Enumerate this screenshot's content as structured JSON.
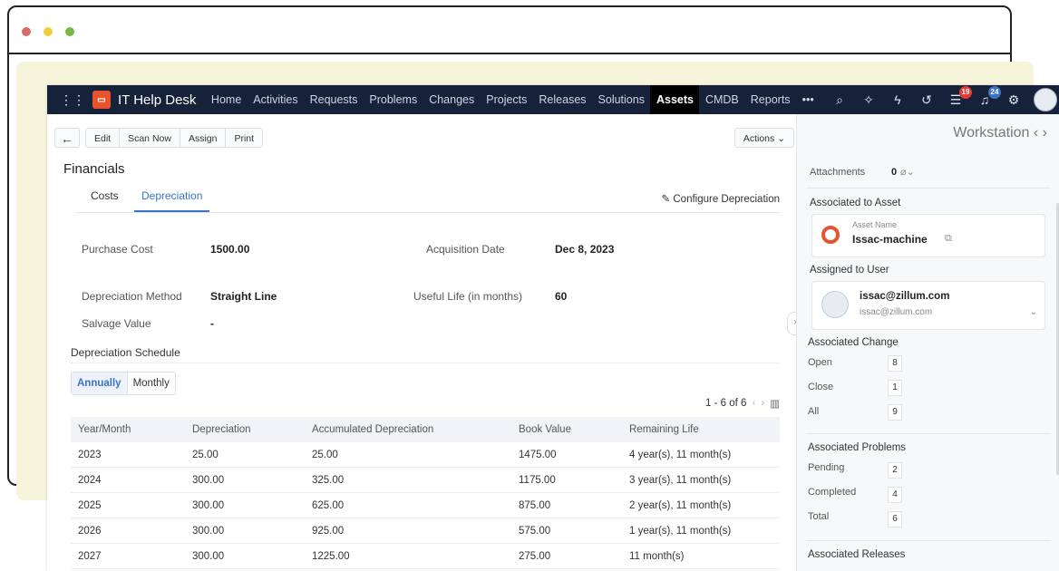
{
  "window": {
    "dot_colors": [
      "#d96b6b",
      "#f2cc3f",
      "#7ab648"
    ]
  },
  "nav": {
    "brand": "IT Help Desk",
    "items": [
      "Home",
      "Activities",
      "Requests",
      "Problems",
      "Changes",
      "Projects",
      "Releases",
      "Solutions",
      "Assets",
      "CMDB",
      "Reports",
      "•••"
    ],
    "active": "Assets",
    "badges": {
      "tasks": "19",
      "notifications": "24"
    }
  },
  "toolbar": {
    "edit": "Edit",
    "scan_now": "Scan Now",
    "assign": "Assign",
    "print": "Print",
    "actions": "Actions ⌄"
  },
  "financials": {
    "title": "Financials",
    "tabs": [
      "Costs",
      "Depreciation"
    ],
    "configure": "Configure Depreciation",
    "fields": {
      "purchase_cost_label": "Purchase Cost",
      "purchase_cost": "1500.00",
      "acq_date_label": "Acquisition Date",
      "acq_date": "Dec 8, 2023",
      "method_label": "Depreciation Method",
      "method": "Straight Line",
      "life_label": "Useful Life (in months)",
      "life": "60",
      "salvage_label": "Salvage Value",
      "salvage": "-"
    },
    "schedule_title": "Depreciation Schedule",
    "toggle": [
      "Annually",
      "Monthly"
    ],
    "pager": "1 - 6 of 6",
    "columns": [
      "Year/Month",
      "Depreciation",
      "Accumulated Depreciation",
      "Book Value",
      "Remaining Life"
    ],
    "rows": [
      [
        "2023",
        "25.00",
        "25.00",
        "1475.00",
        "4 year(s), 11 month(s)"
      ],
      [
        "2024",
        "300.00",
        "325.00",
        "1175.00",
        "3 year(s), 11 month(s)"
      ],
      [
        "2025",
        "300.00",
        "625.00",
        "875.00",
        "2 year(s), 11 month(s)"
      ],
      [
        "2026",
        "300.00",
        "925.00",
        "575.00",
        "1 year(s), 11 month(s)"
      ],
      [
        "2027",
        "300.00",
        "1225.00",
        "275.00",
        "11 month(s)"
      ]
    ]
  },
  "side": {
    "title": "Workstation",
    "attachments_label": "Attachments",
    "attachments_count": "0",
    "assoc_asset": "Associated to Asset",
    "asset_name_label": "Asset Name",
    "asset_name": "Issac-machine",
    "assigned_user": "Assigned to User",
    "user_email": "issac@zillum.com",
    "user_sub": "issac@zillum.com",
    "assoc_change": "Associated Change",
    "change_rows": [
      [
        "Open",
        "8"
      ],
      [
        "Close",
        "1"
      ],
      [
        "All",
        "9"
      ]
    ],
    "assoc_problems": "Associated Problems",
    "problem_rows": [
      [
        "Pending",
        "2"
      ],
      [
        "Completed",
        "4"
      ],
      [
        "Total",
        "6"
      ]
    ],
    "assoc_releases": "Associated Releases"
  }
}
